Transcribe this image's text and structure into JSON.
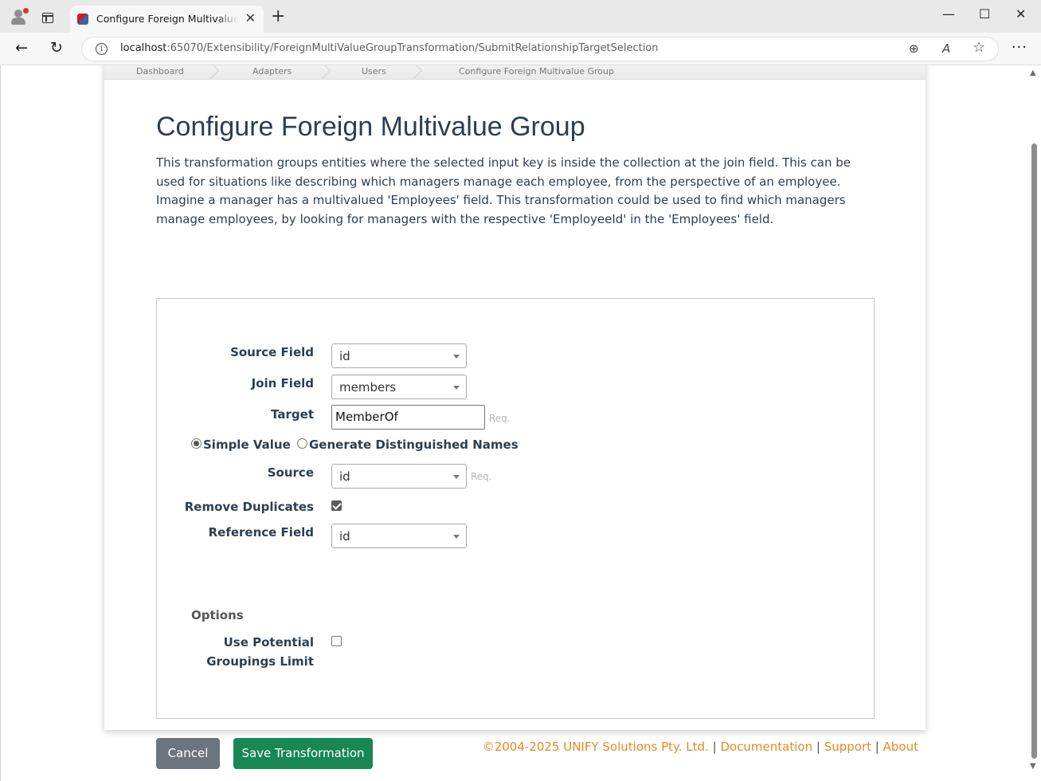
{
  "browser": {
    "tab_title": "Configure Foreign Multivalue Group",
    "tab_close": "✕",
    "new_tab": "+",
    "url_host": "localhost",
    "url_path": ":65070/Extensibility/ForeignMultiValueGroupTransformation/SubmitRelationshipTargetSelection",
    "window_minimize": "—",
    "window_maximize": "☐",
    "window_close": "✕",
    "back": "←",
    "reload": "↻",
    "more": "···",
    "zoom": "⊕",
    "read_aloud": "A",
    "favorite": "☆",
    "info": "i"
  },
  "breadcrumb": [
    "Dashboard",
    "Adapters",
    "Users",
    "Configure Foreign Multivalue Group"
  ],
  "page": {
    "title": "Configure Foreign Multivalue Group",
    "description": "This transformation groups entities where the selected input key is inside the collection at the join field. This can be used for situations like describing which managers manage each employee, from the perspective of an employee. Imagine a manager has a multivalued 'Employees' field. This transformation could be used to find which managers manage employees, by looking for managers with the respective 'EmployeeId' in the 'Employees' field."
  },
  "form": {
    "source_field": {
      "label": "Source Field",
      "value": "id"
    },
    "join_field": {
      "label": "Join Field",
      "value": "members"
    },
    "target": {
      "label": "Target",
      "value": "MemberOf",
      "hint": "Req."
    },
    "mode": {
      "simple_value": "Simple Value",
      "generate_dn": "Generate Distinguished Names",
      "selected": "simple_value"
    },
    "source": {
      "label": "Source",
      "value": "id",
      "hint": "Req."
    },
    "remove_duplicates": {
      "label": "Remove Duplicates",
      "checked": true
    },
    "reference_field": {
      "label": "Reference Field",
      "value": "id"
    },
    "options_heading": "Options",
    "use_potential_groupings_limit": {
      "label_line1": "Use Potential",
      "label_line2": "Groupings Limit",
      "checked": false
    }
  },
  "actions": {
    "cancel": "Cancel",
    "save": "Save Transformation"
  },
  "footer": {
    "copyright": "©2004-2025 UNIFY Solutions Pty. Ltd.",
    "sep": "|",
    "documentation": "Documentation",
    "support": "Support",
    "about": "About"
  },
  "colors": {
    "title": "#2d3e50",
    "save_button": "#198754",
    "cancel_button": "#6c757d",
    "footer_link": "#e58a1f"
  }
}
